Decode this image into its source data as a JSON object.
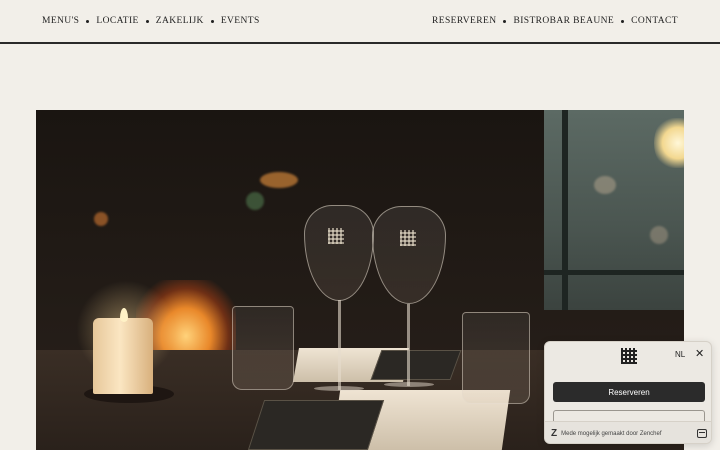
{
  "nav_left": [
    {
      "label": "MENU'S"
    },
    {
      "label": "LOCATIE"
    },
    {
      "label": "ZAKELIJK"
    },
    {
      "label": "EVENTS"
    }
  ],
  "nav_right": [
    {
      "label": "RESERVEREN"
    },
    {
      "label": "BISTROBAR BEAUNE"
    },
    {
      "label": "CONTACT"
    }
  ],
  "hero": {
    "image_icon": "restaurant-photo-icon"
  },
  "widget": {
    "logo_icon": "brand-grid-icon",
    "language": "NL",
    "close_icon": "close-icon",
    "primary_button": "Reserveren",
    "footer_icon": "zenchef-icon",
    "footer_text": "Mede mogelijk gemaakt door Zenchef",
    "calendar_icon": "calendar-icon"
  },
  "colors": {
    "background": "#f2efe9",
    "text": "#222222",
    "button": "#2b2b2b"
  }
}
